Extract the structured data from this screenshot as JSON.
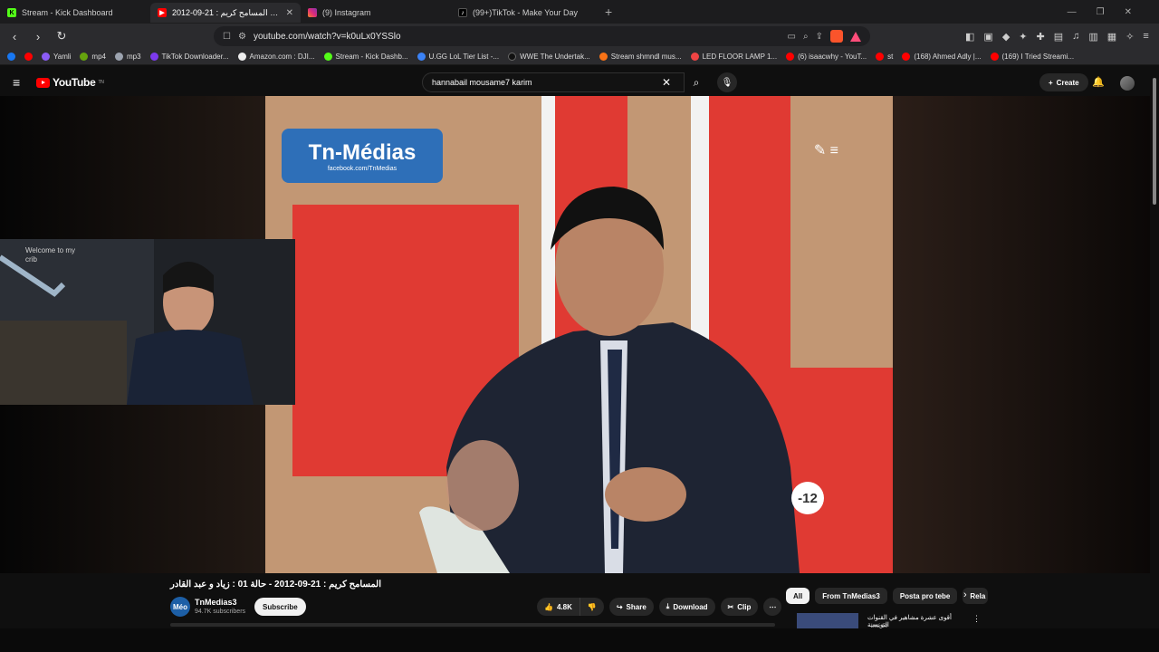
{
  "tabs": [
    {
      "title": "Stream - Kick Dashboard",
      "favicon": "kick",
      "active": false
    },
    {
      "title": "المسامح كريم : 21-09-2012 - ...",
      "favicon": "yt",
      "active": true
    },
    {
      "title": "(9) Instagram",
      "favicon": "ig",
      "active": false
    },
    {
      "title": "(99+)TikTok - Make Your Day",
      "favicon": "tt",
      "active": false
    }
  ],
  "address_bar": {
    "url": "youtube.com/watch?v=k0uLx0YSSlo"
  },
  "bookmarks": [
    "Yamli",
    "mp4",
    "mp3",
    "TikTok Downloader...",
    "Amazon.com : DJI...",
    "Stream - Kick Dashb...",
    "U.GG LoL Tier List -...",
    "WWE The Undertak...",
    "Stream shmndl mus...",
    "LED FLOOR LAMP 1...",
    "(6) isaacwhy - YouT...",
    "st",
    "(168) Ahmed Adly |...",
    "(169) I Tried Streami..."
  ],
  "youtube": {
    "logo_text": "YouTube",
    "logo_sup": "TN",
    "search_value": "hannabail mousame7 karim",
    "create_label": "Create"
  },
  "video": {
    "overlay_logo": "Tn-Médias",
    "overlay_logo_sub": "facebook.com/TnMedias",
    "rating_badge": "-12",
    "webcam_text_1": "Welcome to my",
    "webcam_text_2": "crib",
    "title": "المسامح كريم : 21-09-2012 - حالة 01 : زياد و عبد القادر"
  },
  "channel": {
    "name": "TnMedias3",
    "avatar_text": "Méo",
    "subscribers": "94.7K subscribers",
    "subscribe_label": "Subscribe"
  },
  "actions": {
    "likes": "4.8K",
    "share": "Share",
    "download": "Download",
    "clip": "Clip"
  },
  "chips": [
    "All",
    "From TnMedias3",
    "Posta pro tebe",
    "Rela"
  ],
  "recommendation": {
    "title": "أقوى عشرة مشاهير في القنوات التونسية",
    "sub": "Ima 10"
  },
  "colors": {
    "yt_red": "#ff0000",
    "kick_green": "#53fc18",
    "brave_orange": "#fb542b"
  }
}
